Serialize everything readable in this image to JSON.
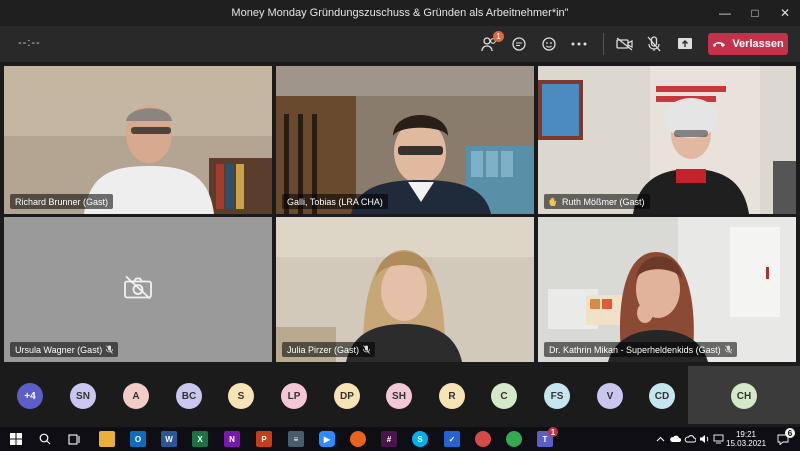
{
  "window": {
    "title": "Money Monday Gründungszuschuss & Gründen als Arbeitnehmer*in\""
  },
  "toolbar": {
    "timer": "--:--",
    "participants_badge": "1",
    "leave_label": "Verlassen"
  },
  "tiles": [
    {
      "name": "Richard Brunner (Gast)"
    },
    {
      "name": "Galli, Tobias (LRA CHA)"
    },
    {
      "name": "Ruth Mößmer (Gast)"
    },
    {
      "name": "Ursula Wagner (Gast)"
    },
    {
      "name": "Julia Pirzer (Gast)"
    },
    {
      "name": "Dr. Kathrin Mikan - Superheldenkids (Gast)"
    }
  ],
  "roster": {
    "overflow": "+4",
    "chips": [
      {
        "initials": "SN",
        "color": "#c9c6f0"
      },
      {
        "initials": "A",
        "color": "#f2ccc6"
      },
      {
        "initials": "BC",
        "color": "#c9c6f0"
      },
      {
        "initials": "S",
        "color": "#f6e3b6"
      },
      {
        "initials": "LP",
        "color": "#f4c7d6"
      },
      {
        "initials": "DP",
        "color": "#f6e3b6"
      },
      {
        "initials": "SH",
        "color": "#f4c7d6"
      },
      {
        "initials": "R",
        "color": "#f6e3b6"
      },
      {
        "initials": "C",
        "color": "#d4e9c8"
      },
      {
        "initials": "FS",
        "color": "#c6e6ef"
      },
      {
        "initials": "V",
        "color": "#c9c6f0"
      },
      {
        "initials": "CD",
        "color": "#c6e6ef"
      },
      {
        "initials": "CH",
        "color": "#d4e9c8"
      }
    ]
  },
  "taskbar": {
    "time": "19:21",
    "date": "15.03.2021",
    "notifications": "6",
    "teams_badge": "1"
  }
}
